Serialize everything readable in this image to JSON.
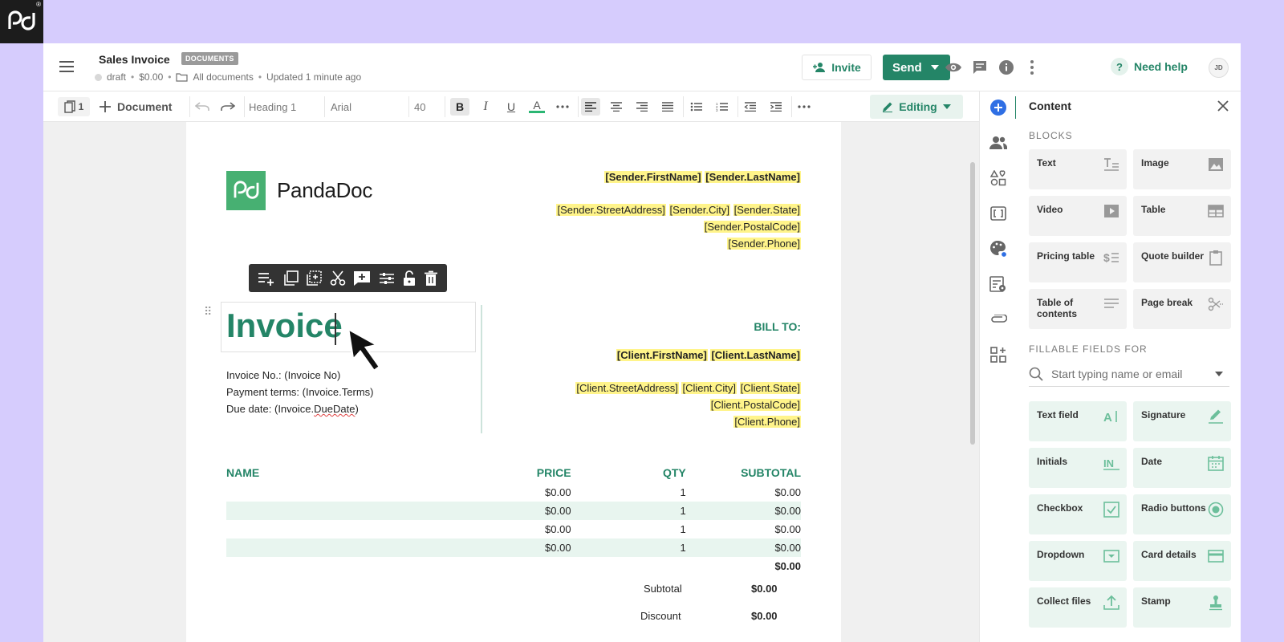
{
  "brand": {
    "corner_logo": "pd",
    "registered": "®",
    "accent": "#248567",
    "logo_green": "#47b072",
    "highlight": "#fff48a"
  },
  "header": {
    "title": "Sales Invoice",
    "tag": "DOCUMENTS",
    "status": "draft",
    "amount": "$0.00",
    "folder": "All documents",
    "updated": "Updated 1 minute ago",
    "invite_label": "Invite",
    "send_label": "Send",
    "need_help_label": "Need help",
    "avatar_initials": "JD"
  },
  "toolbar": {
    "page_count": "1",
    "document_label": "Document",
    "style": "Heading 1",
    "font": "Arial",
    "size": "40",
    "editing_label": "Editing"
  },
  "document": {
    "logo_text": "PandaDoc",
    "sender": {
      "name_first": "[Sender.FirstName]",
      "name_last": "[Sender.LastName]",
      "street": "[Sender.StreetAddress]",
      "city": "[Sender.City]",
      "state": "[Sender.State]",
      "postal": "[Sender.PostalCode]",
      "phone": "[Sender.Phone]"
    },
    "title": "Invoice",
    "invoice_no": "Invoice No.: (Invoice No)",
    "payment_terms": "Payment terms: (Invoice.Terms)",
    "due_date_prefix": "Due date: (Invoice.",
    "due_date_word": "DueDate",
    "due_date_suffix": ")",
    "bill_to": "BILL TO:",
    "client": {
      "name_first": "[Client.FirstName]",
      "name_last": "[Client.LastName]",
      "street": "[Client.StreetAddress]",
      "city": "[Client.City]",
      "state": "[Client.State]",
      "postal": "[Client.PostalCode]",
      "phone": "[Client.Phone]"
    },
    "table": {
      "headers": [
        "NAME",
        "PRICE",
        "QTY",
        "SUBTOTAL"
      ],
      "rows": [
        {
          "name": "",
          "price": "$0.00",
          "qty": "1",
          "subtotal": "$0.00"
        },
        {
          "name": "",
          "price": "$0.00",
          "qty": "1",
          "subtotal": "$0.00"
        },
        {
          "name": "",
          "price": "$0.00",
          "qty": "1",
          "subtotal": "$0.00"
        },
        {
          "name": "",
          "price": "$0.00",
          "qty": "1",
          "subtotal": "$0.00"
        }
      ],
      "total": "$0.00"
    },
    "summary": {
      "subtotal_label": "Subtotal",
      "subtotal_value": "$0.00",
      "discount_label": "Discount",
      "discount_value": "$0.00"
    }
  },
  "panel": {
    "title": "Content",
    "blocks_label": "BLOCKS",
    "blocks": [
      {
        "label": "Text",
        "icon": "text-block-icon"
      },
      {
        "label": "Image",
        "icon": "image-icon"
      },
      {
        "label": "Video",
        "icon": "video-icon"
      },
      {
        "label": "Table",
        "icon": "table-icon"
      },
      {
        "label": "Pricing table",
        "icon": "pricing-table-icon"
      },
      {
        "label": "Quote builder",
        "icon": "quote-builder-icon"
      },
      {
        "label": "Table of contents",
        "icon": "toc-icon"
      },
      {
        "label": "Page break",
        "icon": "page-break-icon"
      }
    ],
    "fields_label": "FILLABLE FIELDS FOR",
    "search_placeholder": "Start typing name or email",
    "fields": [
      {
        "label": "Text field",
        "icon": "text-field-icon"
      },
      {
        "label": "Signature",
        "icon": "signature-icon"
      },
      {
        "label": "Initials",
        "icon": "initials-icon"
      },
      {
        "label": "Date",
        "icon": "calendar-icon"
      },
      {
        "label": "Checkbox",
        "icon": "checkbox-icon"
      },
      {
        "label": "Radio buttons",
        "icon": "radio-icon"
      },
      {
        "label": "Dropdown",
        "icon": "dropdown-icon"
      },
      {
        "label": "Card details",
        "icon": "card-icon"
      },
      {
        "label": "Collect files",
        "icon": "upload-icon"
      },
      {
        "label": "Stamp",
        "icon": "stamp-icon"
      }
    ]
  }
}
